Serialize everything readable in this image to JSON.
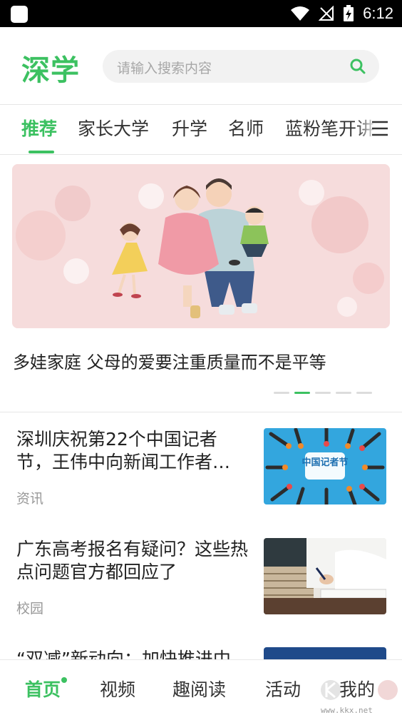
{
  "status_bar": {
    "time": "6:12"
  },
  "header": {
    "logo": "深学",
    "search_placeholder": "请输入搜索内容"
  },
  "tabs": [
    {
      "label": "推荐",
      "active": true
    },
    {
      "label": "家长大学",
      "active": false
    },
    {
      "label": "升学",
      "active": false
    },
    {
      "label": "名师",
      "active": false
    },
    {
      "label": "蓝粉笔开讲",
      "active": false
    }
  ],
  "banner": {
    "title": "多娃家庭 父母的爱要注重质量而不是平等",
    "slide_count": 5,
    "active_slide": 2
  },
  "news": [
    {
      "title": "深圳庆祝第22个中国记者节，王伟中向新闻工作者…",
      "category": "资讯",
      "thumb_text": "中国记者节"
    },
    {
      "title": "广东高考报名有疑问？这些热点问题官方都回应了",
      "category": "校园"
    },
    {
      "title": "“双减”新动向：加快推进中"
    }
  ],
  "bottom_nav": [
    {
      "label": "首页",
      "active": true
    },
    {
      "label": "视频",
      "active": false
    },
    {
      "label": "趣阅读",
      "active": false
    },
    {
      "label": "活动",
      "active": false
    },
    {
      "label": "我的",
      "active": false
    }
  ],
  "watermark": {
    "url": "www.kkx.net"
  },
  "colors": {
    "accent": "#3cc161",
    "text": "#222222",
    "muted": "#999999"
  }
}
